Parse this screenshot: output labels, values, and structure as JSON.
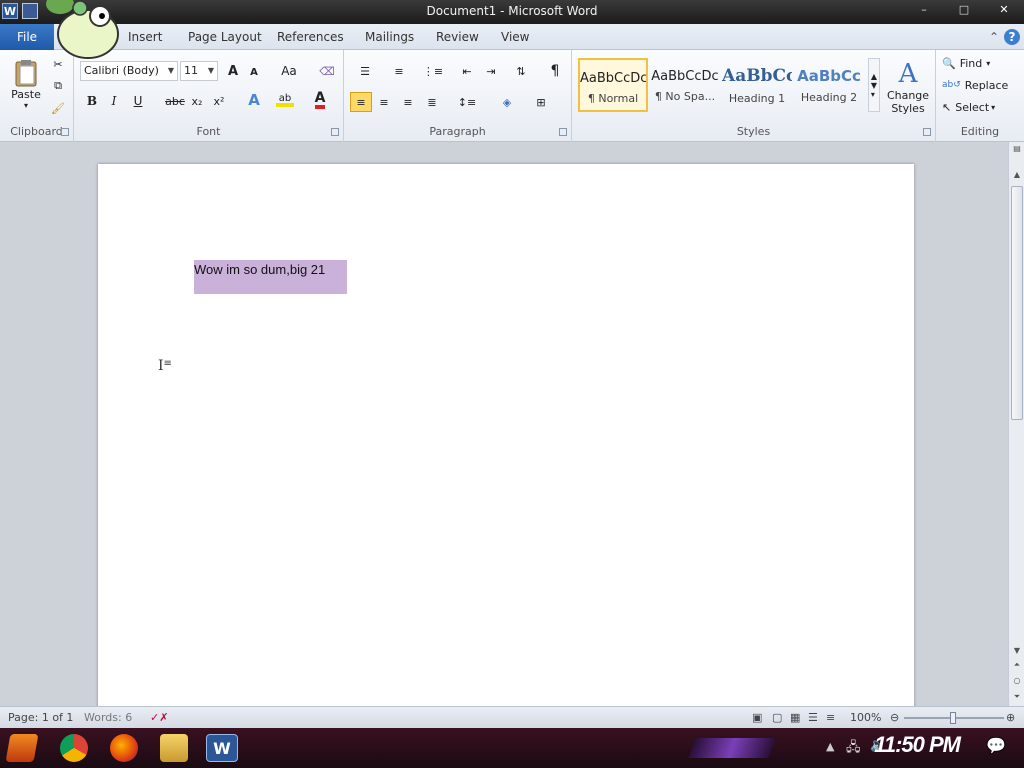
{
  "window": {
    "title": "Document1 - Microsoft Word",
    "minimize": "–",
    "maximize": "□",
    "close": "✕"
  },
  "qat": {
    "app_icon": "W"
  },
  "tabs": {
    "file": "File",
    "items": [
      "Insert",
      "Page Layout",
      "References",
      "Mailings",
      "Review",
      "View"
    ]
  },
  "ribbon": {
    "clipboard": {
      "label": "Clipboard",
      "paste": "Paste"
    },
    "font": {
      "label": "Font",
      "font_name": "Calibri (Body)",
      "font_size": "11",
      "bold": "B",
      "italic": "I",
      "underline": "U",
      "strike": "abc",
      "subscript": "x₂",
      "superscript": "x²",
      "grow": "A",
      "shrink": "A",
      "change_case": "Aa",
      "font_color": "A"
    },
    "paragraph": {
      "label": "Paragraph",
      "pilcrow": "¶"
    },
    "styles": {
      "label": "Styles",
      "cards": [
        {
          "sample": "AaBbCcDc",
          "label": "¶ Normal"
        },
        {
          "sample": "AaBbCcDc",
          "label": "¶ No Spa..."
        },
        {
          "sample": "AaBbCc",
          "label": "Heading 1"
        },
        {
          "sample": "AaBbCc",
          "label": "Heading 2"
        }
      ],
      "change_styles": "Change Styles"
    },
    "editing": {
      "label": "Editing",
      "find": "Find",
      "replace": "Replace",
      "select": "Select"
    }
  },
  "document": {
    "text": "Wow im so dum,big 21"
  },
  "status": {
    "page": "Page: 1 of 1",
    "words": "Words: 6",
    "zoom": "100%"
  },
  "taskbar": {
    "clock": "11:50 PM"
  },
  "colors": {
    "selection": "#c9b1da",
    "file_tab": "#2b67b8"
  }
}
